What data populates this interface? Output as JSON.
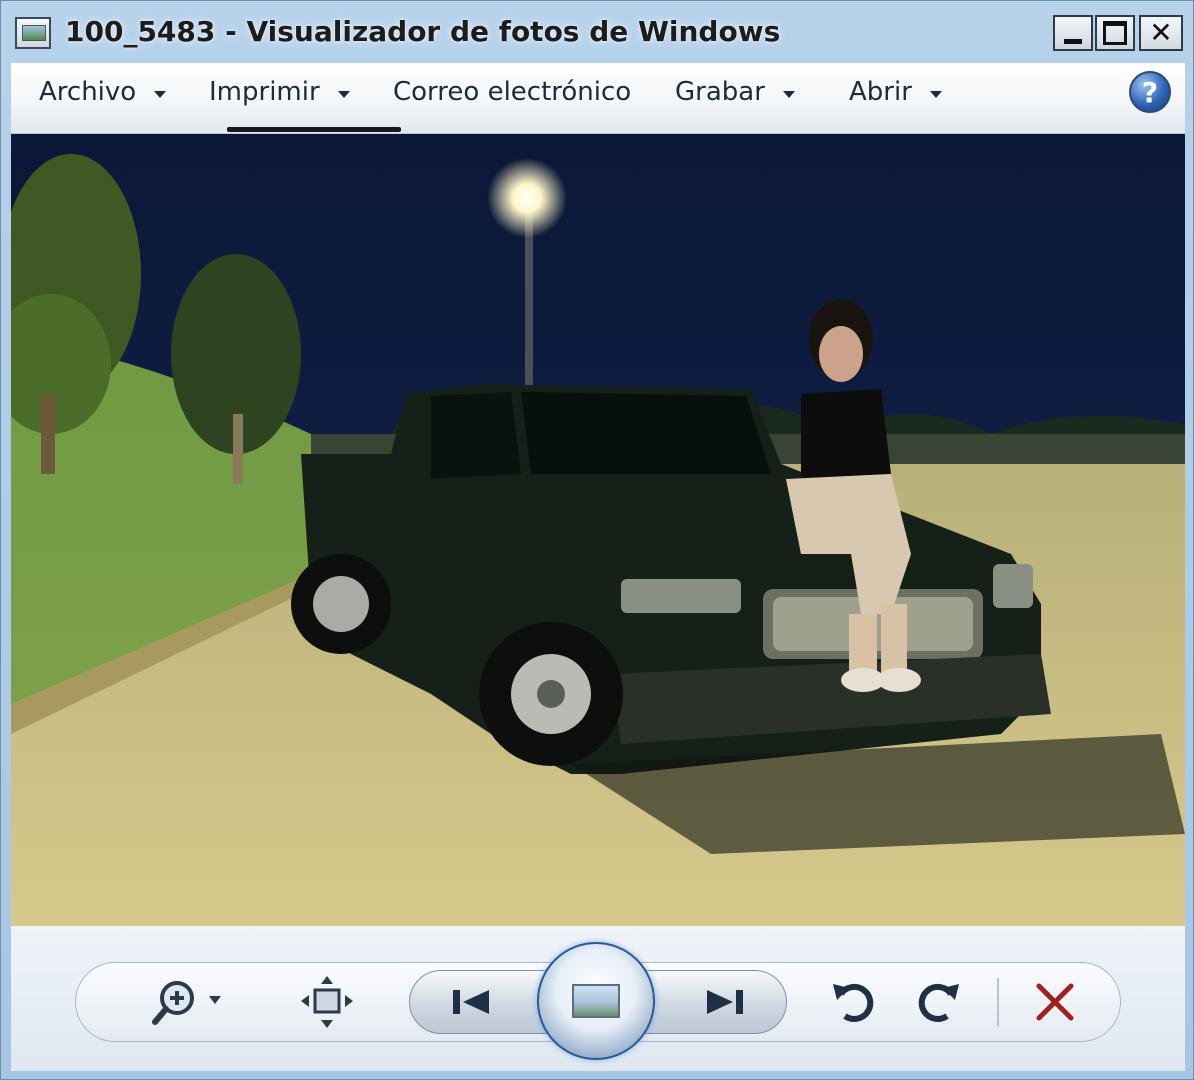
{
  "window": {
    "title": "100_5483 - Visualizador de fotos de Windows"
  },
  "menu": {
    "items": [
      {
        "label": "Archivo",
        "has_dropdown": true
      },
      {
        "label": "Imprimir",
        "has_dropdown": true
      },
      {
        "label": "Correo electrónico",
        "has_dropdown": false
      },
      {
        "label": "Grabar",
        "has_dropdown": true
      },
      {
        "label": "Abrir",
        "has_dropdown": true
      }
    ],
    "help_icon": "help-icon"
  },
  "photo": {
    "subject": "pickup truck photo"
  },
  "controls": {
    "icons": [
      "zoom-icon",
      "fit-to-window-icon",
      "previous-icon",
      "slideshow-icon",
      "next-icon",
      "rotate-counterclockwise-icon",
      "rotate-clockwise-icon",
      "delete-icon"
    ]
  },
  "colors": {
    "frame": "#b7d2ea",
    "delete": "#a2201c",
    "control_blue": "#2b5a95"
  }
}
